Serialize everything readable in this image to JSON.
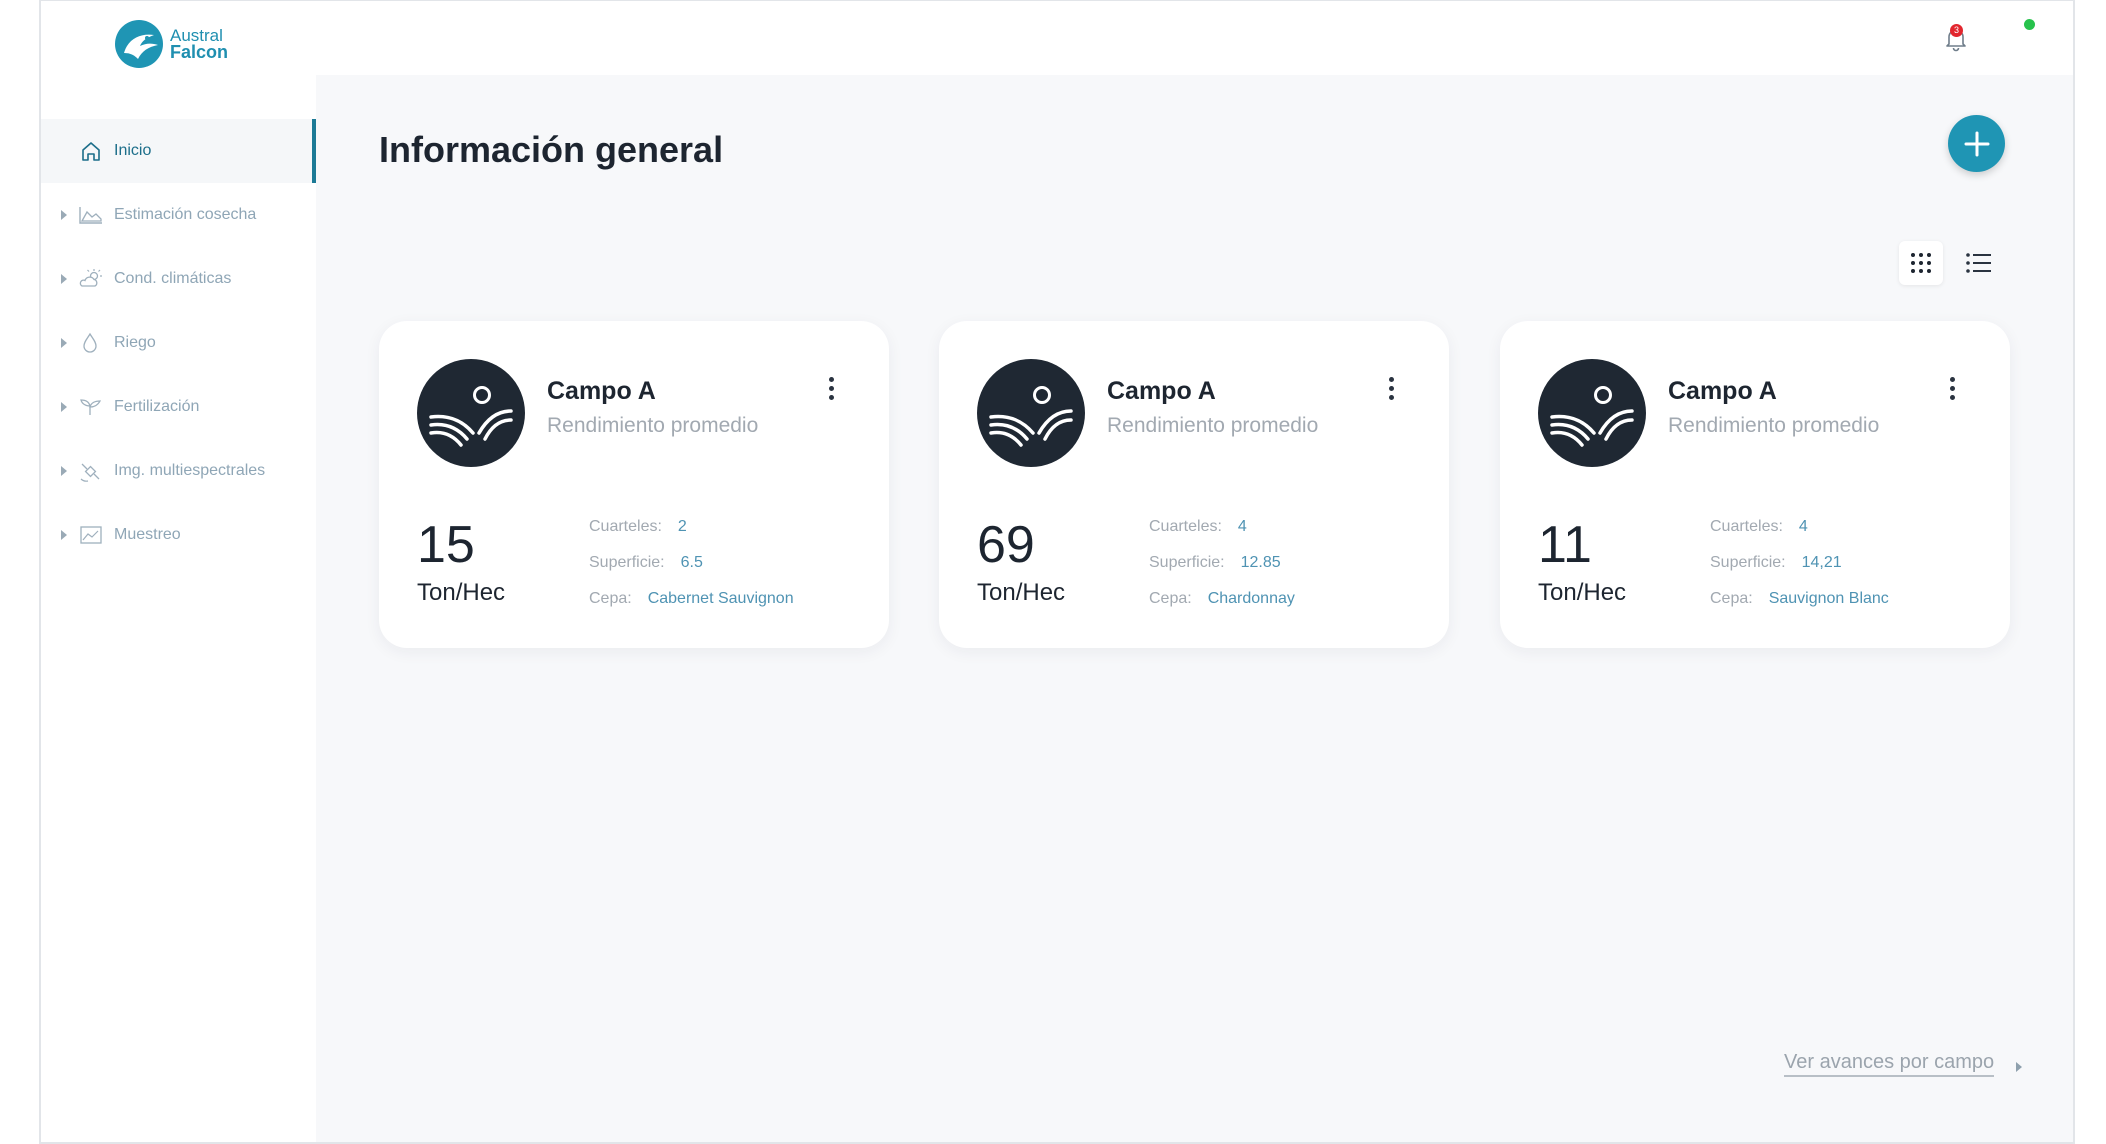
{
  "brand": {
    "line1": "Austral",
    "line2": "Falcon"
  },
  "sidebar": {
    "items": [
      {
        "label": "Inicio",
        "icon": "home-icon",
        "active": true
      },
      {
        "label": "Estimación cosecha",
        "icon": "chart-area-icon"
      },
      {
        "label": "Cond. climáticas",
        "icon": "cloud-sun-icon"
      },
      {
        "label": "Riego",
        "icon": "water-drop-icon"
      },
      {
        "label": "Fertilización",
        "icon": "sprout-icon"
      },
      {
        "label": "Img. multiespectrales",
        "icon": "satellite-icon"
      },
      {
        "label": "Muestreo",
        "icon": "image-chart-icon"
      }
    ]
  },
  "header": {
    "notification_count": "3",
    "status_color": "#27c24c"
  },
  "main": {
    "title": "Información general",
    "cards": [
      {
        "name": "Campo A",
        "subtitle": "Rendimiento promedio",
        "value": "15",
        "unit": "Ton/Hec",
        "cuarteles_label": "Cuarteles:",
        "cuarteles": "2",
        "superficie_label": "Superficie:",
        "superficie": "6.5",
        "cepa_label": "Cepa:",
        "cepa": "Cabernet Sauvignon"
      },
      {
        "name": "Campo A",
        "subtitle": "Rendimiento promedio",
        "value": "69",
        "unit": "Ton/Hec",
        "cuarteles_label": "Cuarteles:",
        "cuarteles": "4",
        "superficie_label": "Superficie:",
        "superficie": "12.85",
        "cepa_label": "Cepa:",
        "cepa": "Chardonnay"
      },
      {
        "name": "Campo A",
        "subtitle": "Rendimiento promedio",
        "value": "11",
        "unit": "Ton/Hec",
        "cuarteles_label": "Cuarteles:",
        "cuarteles": "4",
        "superficie_label": "Superficie:",
        "superficie": "14,21",
        "cepa_label": "Cepa:",
        "cepa": "Sauvignon Blanc"
      }
    ],
    "footer_link": "Ver avances por campo"
  },
  "colors": {
    "accent": "#1f95b4",
    "sidebar_active": "#1c7a96",
    "card_icon_bg": "#1f2833"
  }
}
